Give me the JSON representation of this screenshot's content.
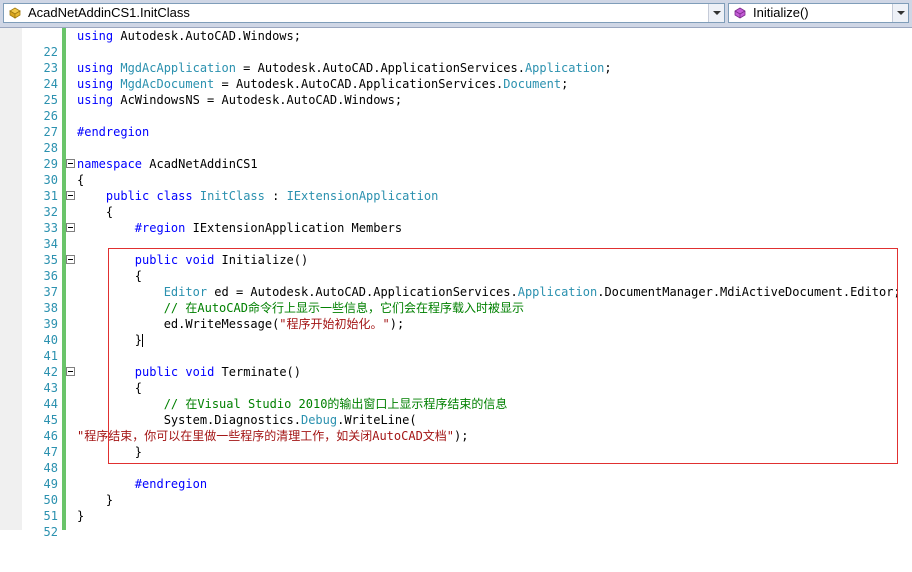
{
  "navigation_bar": {
    "type_combo": {
      "label": "AcadNetAddinCS1.InitClass",
      "icon": "class-icon"
    },
    "member_combo": {
      "label": "Initialize()",
      "icon": "method-icon"
    }
  },
  "editor": {
    "lines": [
      {
        "number": "22",
        "code": "using Autodesk.AutoCAD.Windows;"
      },
      {
        "number": "23",
        "code": ""
      },
      {
        "number": "24",
        "code": "using MgdAcApplication = Autodesk.AutoCAD.ApplicationServices.Application;"
      },
      {
        "number": "25",
        "code": "using MgdAcDocument = Autodesk.AutoCAD.ApplicationServices.Document;"
      },
      {
        "number": "26",
        "code": "using AcWindowsNS = Autodesk.AutoCAD.Windows;"
      },
      {
        "number": "27",
        "code": ""
      },
      {
        "number": "28",
        "code": "#endregion"
      },
      {
        "number": "29",
        "code": ""
      },
      {
        "number": "30",
        "code": "namespace AcadNetAddinCS1"
      },
      {
        "number": "31",
        "code": "{"
      },
      {
        "number": "32",
        "code": "    public class InitClass : IExtensionApplication"
      },
      {
        "number": "33",
        "code": "    {"
      },
      {
        "number": "34",
        "code": "        #region IExtensionApplication Members"
      },
      {
        "number": "35",
        "code": ""
      },
      {
        "number": "36",
        "code": "        public void Initialize()"
      },
      {
        "number": "37",
        "code": "        {"
      },
      {
        "number": "38",
        "code": "            Editor ed = Autodesk.AutoCAD.ApplicationServices.Application.DocumentManager.MdiActiveDocument.Editor;"
      },
      {
        "number": "39",
        "code": "            // 在AutoCAD命令行上显示一些信息，它们会在程序载入时被显示"
      },
      {
        "number": "40",
        "code": "            ed.WriteMessage(\"程序开始初始化。\");"
      },
      {
        "number": "41",
        "code": "        }"
      },
      {
        "number": "42",
        "code": ""
      },
      {
        "number": "43",
        "code": "        public void Terminate()"
      },
      {
        "number": "44",
        "code": "        {"
      },
      {
        "number": "45",
        "code": "            // 在Visual Studio 2010的输出窗口上显示程序结束的信息"
      },
      {
        "number": "46",
        "code": "            System.Diagnostics.Debug.WriteLine("
      },
      {
        "number": "47",
        "code": "\"程序结束，你可以在里做一些程序的清理工作，如关闭AutoCAD文档\");"
      },
      {
        "number": "48",
        "code": "        }"
      },
      {
        "number": "49",
        "code": ""
      },
      {
        "number": "50",
        "code": "        #endregion"
      },
      {
        "number": "51",
        "code": "    }"
      },
      {
        "number": "52",
        "code": "}"
      }
    ]
  },
  "colors": {
    "keyword": "#0000ff",
    "type": "#2b91af",
    "comment": "#008000",
    "string": "#a31515",
    "line_number": "#2b91af",
    "change_bar": "#6ac46a",
    "highlight_box": "#e03030"
  }
}
